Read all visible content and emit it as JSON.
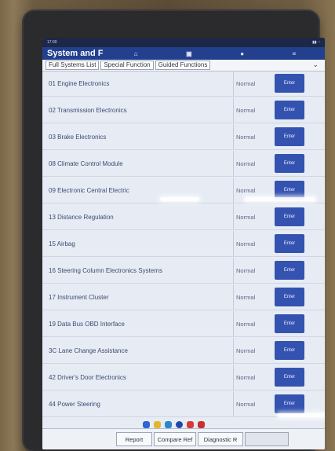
{
  "statusbar": {
    "time": "17:00",
    "right": ""
  },
  "header": {
    "title": "System and F"
  },
  "tabs": [
    "Full Systems List",
    "Special Function",
    "Guided Functions"
  ],
  "systems": [
    {
      "name": "01 Engine Electronics",
      "status": "Normal",
      "button": "Enter"
    },
    {
      "name": "02 Transmission Electronics",
      "status": "Normal",
      "button": "Enter"
    },
    {
      "name": "03 Brake Electronics",
      "status": "Normal",
      "button": "Enter"
    },
    {
      "name": "08 Climate Control Module",
      "status": "Normal",
      "button": "Enter"
    },
    {
      "name": "09 Electronic Central Electric",
      "status": "Normal",
      "button": "Enter"
    },
    {
      "name": "13 Distance Regulation",
      "status": "Normal",
      "button": "Enter"
    },
    {
      "name": "15 Airbag",
      "status": "Normal",
      "button": "Enter"
    },
    {
      "name": "16 Steering Column Electronics Systems",
      "status": "Normal",
      "button": "Enter"
    },
    {
      "name": "17 Instrument Cluster",
      "status": "Normal",
      "button": "Enter"
    },
    {
      "name": "19 Data Bus OBD Interface",
      "status": "Normal",
      "button": "Enter"
    },
    {
      "name": "3C Lane Change Assistance",
      "status": "Normal",
      "button": "Enter"
    },
    {
      "name": "42 Driver's Door Electronics",
      "status": "Normal",
      "button": "Enter"
    },
    {
      "name": "44 Power Steering",
      "status": "Normal",
      "button": "Enter"
    }
  ],
  "bottom": {
    "report": "Report",
    "compare": "Compare Ref",
    "diagnostic": "Diagnostic R"
  }
}
